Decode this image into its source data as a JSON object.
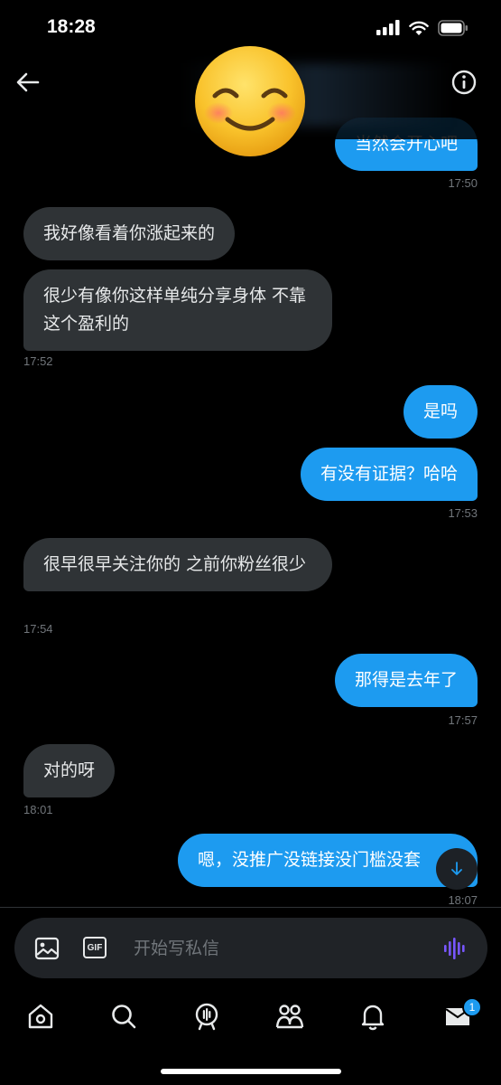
{
  "status": {
    "time": "18:28"
  },
  "header": {
    "back_icon": "arrow-left-icon",
    "info_icon": "info-icon",
    "avatar": "smiling-face-emoji"
  },
  "messages": [
    {
      "dir": "out",
      "text": "当然会开心吧",
      "time": "17:50"
    },
    {
      "dir": "in",
      "text": "我好像看着你涨起来的",
      "time": ""
    },
    {
      "dir": "in",
      "text": "很少有像你这样单纯分享身体 不靠这个盈利的",
      "time": "17:52"
    },
    {
      "dir": "out",
      "text": "是吗",
      "time": ""
    },
    {
      "dir": "out",
      "text": "有没有证据？哈哈",
      "time": "17:53"
    },
    {
      "dir": "in",
      "text": "很早很早关注你的 之前你粉丝很少",
      "time": "17:54"
    },
    {
      "dir": "out",
      "text": "那得是去年了",
      "time": "17:57"
    },
    {
      "dir": "in",
      "text": "对的呀",
      "time": "18:01"
    },
    {
      "dir": "out",
      "text": "嗯，没推广没链接没门槛没套",
      "time": "18:07"
    }
  ],
  "composer": {
    "placeholder": "开始写私信",
    "gif_label": "GIF",
    "image_icon": "image-icon",
    "voice_icon": "voice-wave-icon"
  },
  "nav": {
    "items": [
      "home-icon",
      "search-icon",
      "spaces-icon",
      "communities-icon",
      "notifications-icon",
      "messages-icon"
    ],
    "messages_badge": "1"
  },
  "colors": {
    "accent": "#1d9bf0",
    "incoming_bubble": "#2f3336",
    "background": "#000000",
    "voice_icon": "#7856ff"
  }
}
